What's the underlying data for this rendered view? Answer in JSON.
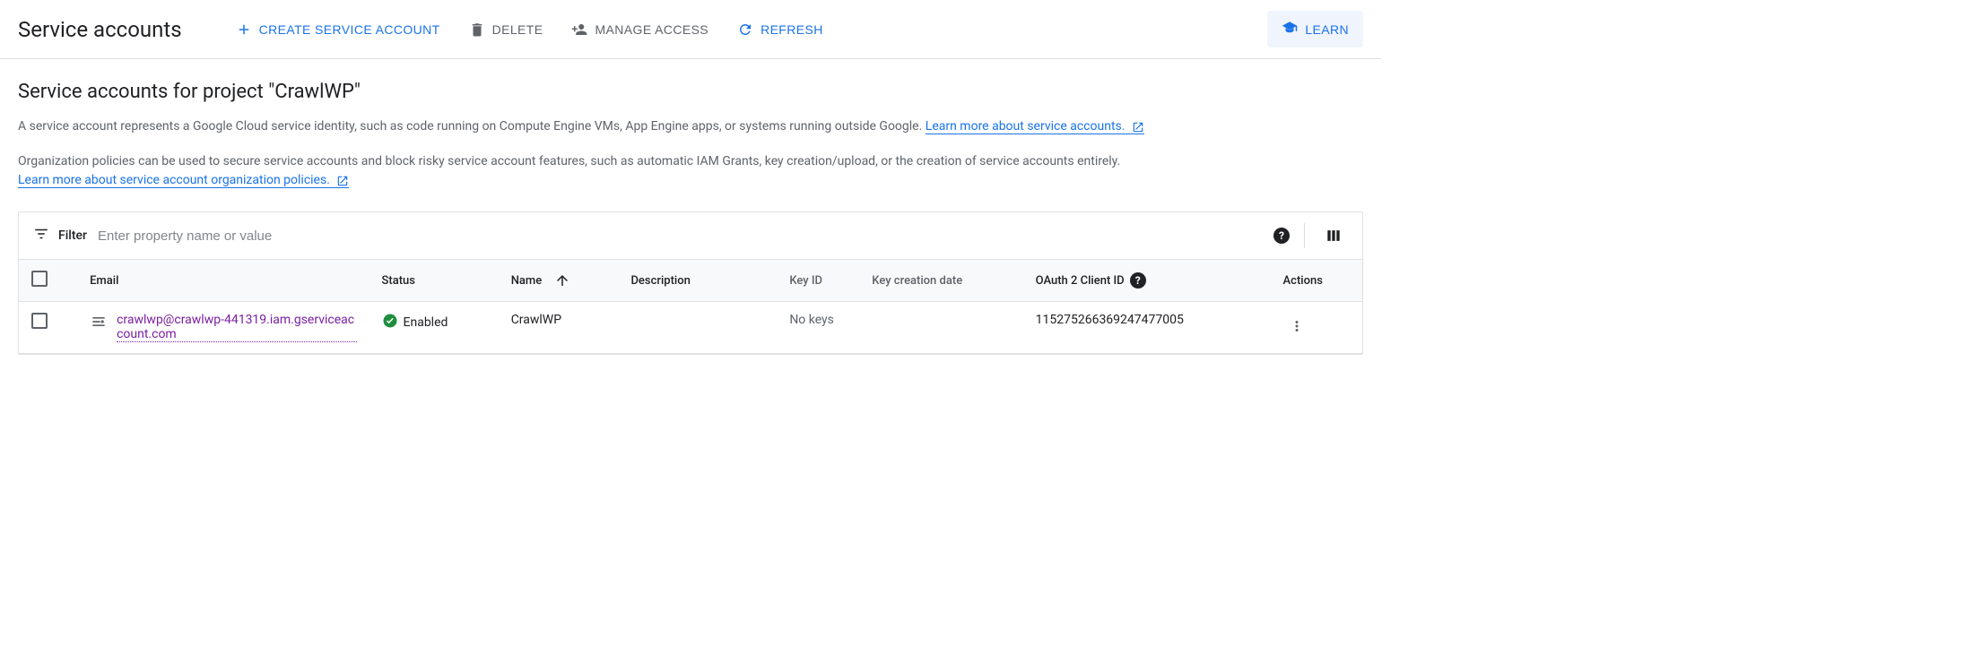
{
  "header": {
    "title": "Service accounts",
    "create": "CREATE SERVICE ACCOUNT",
    "delete": "DELETE",
    "manage": "MANAGE ACCESS",
    "refresh": "REFRESH",
    "learn": "LEARN"
  },
  "body": {
    "subtitle": "Service accounts for project \"CrawlWP\"",
    "desc1": "A service account represents a Google Cloud service identity, such as code running on Compute Engine VMs, App Engine apps, or systems running outside Google. ",
    "link1": "Learn more about service accounts.",
    "desc2": "Organization policies can be used to secure service accounts and block risky service account features, such as automatic IAM Grants, key creation/upload, or the creation of service accounts entirely. ",
    "link2": "Learn more about service account organization policies."
  },
  "filter": {
    "label": "Filter",
    "placeholder": "Enter property name or value"
  },
  "table": {
    "headers": {
      "email": "Email",
      "status": "Status",
      "name": "Name",
      "description": "Description",
      "keyid": "Key ID",
      "keydate": "Key creation date",
      "oauth": "OAuth 2 Client ID",
      "actions": "Actions"
    },
    "rows": [
      {
        "email": "crawlwp@crawlwp-441319.iam.gserviceaccount.com",
        "status": "Enabled",
        "name": "CrawlWP",
        "description": "",
        "keyid": "No keys",
        "keydate": "",
        "oauth": "115275266369247477005"
      }
    ]
  }
}
